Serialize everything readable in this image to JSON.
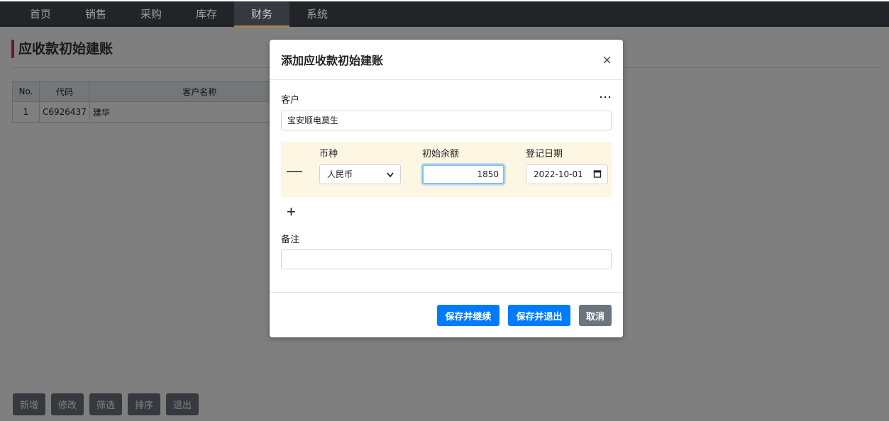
{
  "nav": {
    "items": [
      {
        "label": "首页"
      },
      {
        "label": "销售"
      },
      {
        "label": "采购"
      },
      {
        "label": "库存"
      },
      {
        "label": "财务",
        "active": true
      },
      {
        "label": "系统"
      }
    ]
  },
  "page": {
    "title": "应收款初始建账"
  },
  "table": {
    "headers": [
      "No.",
      "代码",
      "客户名称"
    ],
    "rows": [
      {
        "no": "1",
        "code": "C6926437",
        "name": "建华"
      }
    ]
  },
  "bottom_buttons": [
    "新增",
    "修改",
    "筛选",
    "排序",
    "退出"
  ],
  "modal": {
    "title": "添加应收款初始建账",
    "close_symbol": "×",
    "customer_label": "客户",
    "more_symbol": "···",
    "customer_value": "宝安顺电莫生",
    "currency_label": "币种",
    "balance_label": "初始余额",
    "date_label": "登记日期",
    "minus_symbol": "—",
    "plus_symbol": "+",
    "currency_value": "人民币",
    "balance_value": "1850",
    "date_value": "2022-10-01",
    "remark_label": "备注",
    "remark_value": "",
    "save_continue_label": "保存并继续",
    "save_exit_label": "保存并退出",
    "cancel_label": "取消"
  },
  "colors": {
    "primary": "#007bff",
    "secondary": "#6c757d",
    "nav_bg": "#212529",
    "accent_red": "#dc3545",
    "row_highlight": "#fdf6e3"
  }
}
